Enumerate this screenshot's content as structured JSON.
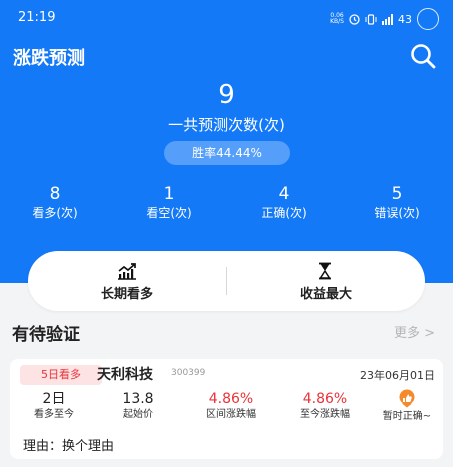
{
  "status_bar": {
    "time": "21:19",
    "net_speed_top": "0.06",
    "net_speed_bottom": "KB/S",
    "battery": "43"
  },
  "header": {
    "title": "涨跌预测"
  },
  "summary": {
    "total": "9",
    "total_label": "一共预测次数(次)",
    "win_rate": "胜率44.44%"
  },
  "stats": [
    {
      "value": "8",
      "label": "看多(次)"
    },
    {
      "value": "1",
      "label": "看空(次)"
    },
    {
      "value": "4",
      "label": "正确(次)"
    },
    {
      "value": "5",
      "label": "错误(次)"
    }
  ],
  "actions": [
    {
      "label": "长期看多",
      "icon": "trend-up-icon"
    },
    {
      "label": "收益最大",
      "icon": "hourglass-icon"
    }
  ],
  "pending": {
    "title": "有待验证",
    "more": "更多 >"
  },
  "card": {
    "tag": "5日看多",
    "name": "天利科技",
    "code": "300399",
    "date": "23年06月01日",
    "metrics": [
      {
        "value": "2日",
        "label": "看多至今"
      },
      {
        "value": "13.8",
        "label": "起始价"
      },
      {
        "value": "4.86%",
        "label": "区间涨跌幅"
      },
      {
        "value": "4.86%",
        "label": "至今涨跌幅"
      }
    ],
    "status_label": "暂时正确~",
    "reason": "理由：换个理由"
  },
  "colors": {
    "brand_blue": "#1479f7",
    "red": "#e8333a",
    "orange": "#e0711f"
  }
}
